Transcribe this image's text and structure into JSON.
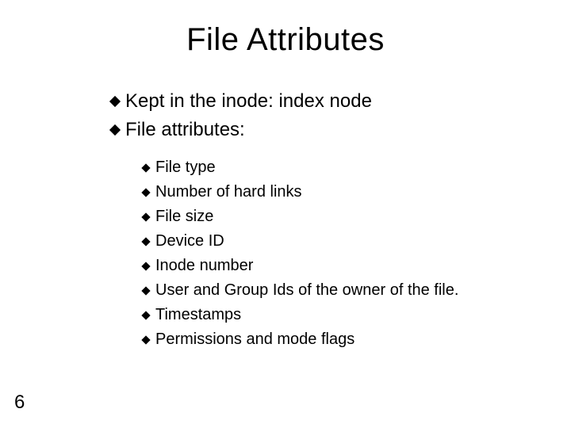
{
  "title": "File Attributes",
  "level1": [
    "Kept in the inode: index node",
    "File attributes:"
  ],
  "level2": [
    "File type",
    "Number of hard links",
    "File size",
    "Device ID",
    "Inode number",
    "User and Group Ids of the owner of the file.",
    "Timestamps",
    "Permissions and mode flags"
  ],
  "page_number": "6"
}
